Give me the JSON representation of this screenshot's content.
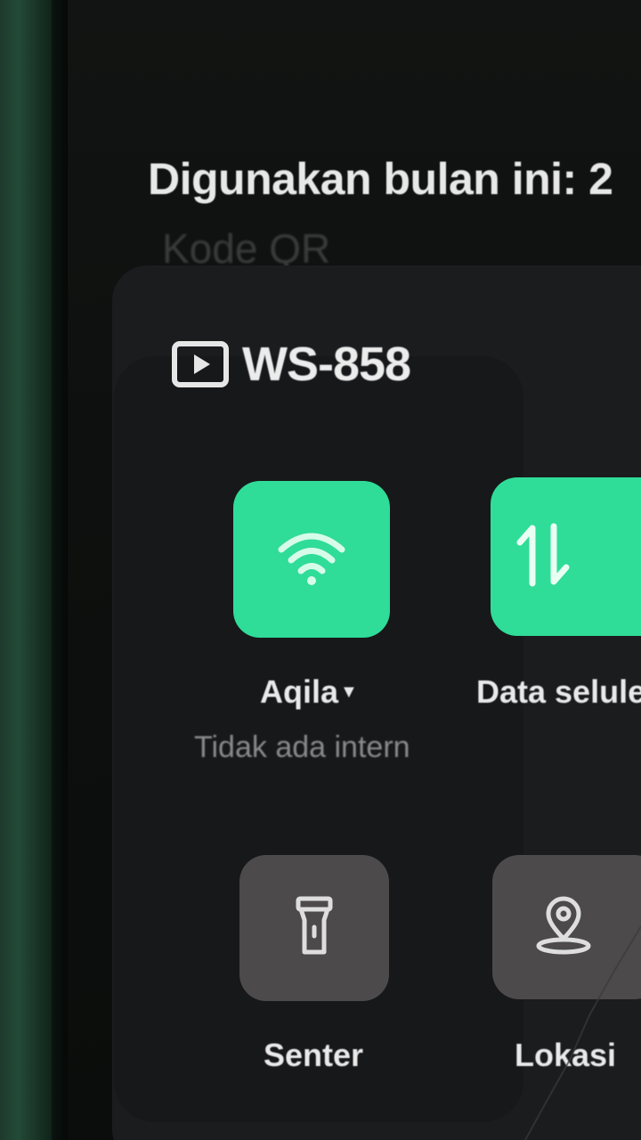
{
  "header": {
    "data_usage": "Digunakan bulan ini: 2",
    "qr_code": "Kode QR"
  },
  "media_output": {
    "device_name": "WS-858",
    "icon": "cast-icon"
  },
  "tiles": {
    "wifi": {
      "label": "Aqila",
      "status": "Tidak ada intern",
      "icon": "wifi-icon",
      "state": "on"
    },
    "mobile_data": {
      "label": "Data selule",
      "icon": "data-arrows-icon",
      "state": "on"
    },
    "flashlight": {
      "label": "Senter",
      "icon": "flashlight-icon",
      "state": "off"
    },
    "location": {
      "label": "Lokasi",
      "icon": "location-pin-icon",
      "state": "off"
    }
  },
  "colors": {
    "active_tile": "#2fdc98",
    "inactive_tile": "#4c4a4b",
    "panel": "#1b1c1e",
    "bezel": "#234a37"
  }
}
